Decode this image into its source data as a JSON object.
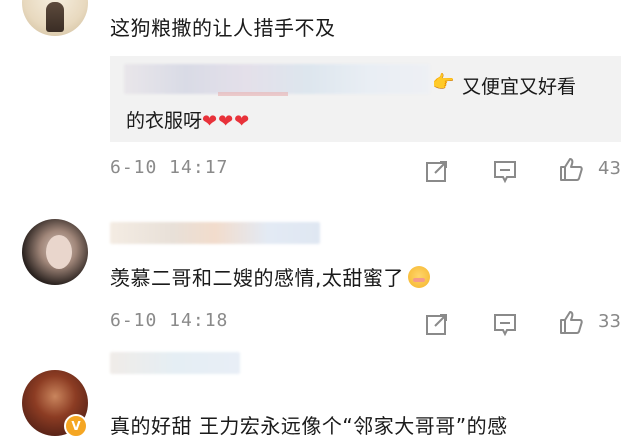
{
  "comments": [
    {
      "text": "这狗粮撒的让人措手不及",
      "quote_line1": "又便宜又好看",
      "quote_line2": "的衣服呀",
      "quote_hearts": "❤❤❤",
      "date": "6-10 14:17",
      "likes": "43",
      "avatar_icon": "avatar-illustration"
    },
    {
      "text": "羡慕二哥和二嫂的感情,太甜蜜了",
      "date": "6-10 14:18",
      "likes": "33",
      "avatar_icon": "avatar-photo"
    },
    {
      "text": "真的好甜 王力宏永远像个“邻家大哥哥”的感",
      "avatar_icon": "avatar-photo",
      "badge": "V"
    }
  ],
  "colors": {
    "text": "#1a1a1a",
    "meta": "#8a8a8a",
    "quote_bg": "#f2f2f2",
    "heart": "#e8323a",
    "badge": "#f5a623"
  },
  "icons": {
    "share": "share-icon",
    "comment": "comment-icon",
    "like": "thumbs-up-icon",
    "pointing": "pointing-hand-icon"
  }
}
